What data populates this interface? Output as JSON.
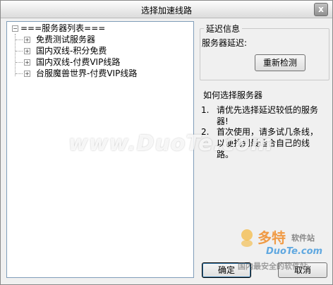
{
  "window": {
    "title": "选择加速线路",
    "close_glyph": "x"
  },
  "tree": {
    "root": {
      "label": "===服务器列表===",
      "expander": "−"
    },
    "items": [
      {
        "label": "免费测试服务器",
        "expander": "+"
      },
      {
        "label": "国内双线-积分免费",
        "expander": "+"
      },
      {
        "label": "国内双线-付费VIP线路",
        "expander": "+"
      },
      {
        "label": "台服魔兽世界-付费VIP线路",
        "expander": "+"
      }
    ]
  },
  "delay_group": {
    "title": "延迟信息",
    "delay_label": "服务器延迟:",
    "retest_button": "重新检测"
  },
  "howto": {
    "title": "如何选择服务器",
    "tips": [
      {
        "num": "1.",
        "text": "请优先选择延迟较低的服务器!"
      },
      {
        "num": "2.",
        "text": "首次使用，请多试几条线，以便找到最适合自己的线路。"
      }
    ]
  },
  "buttons": {
    "ok": "确定",
    "cancel": "取消"
  },
  "watermark": {
    "main": "www.DuoTe.com",
    "logo_text": "多特",
    "logo_sub": "软件站",
    "logo_domain": "DuoTe.com",
    "footer": "国内最安全的软件站"
  }
}
